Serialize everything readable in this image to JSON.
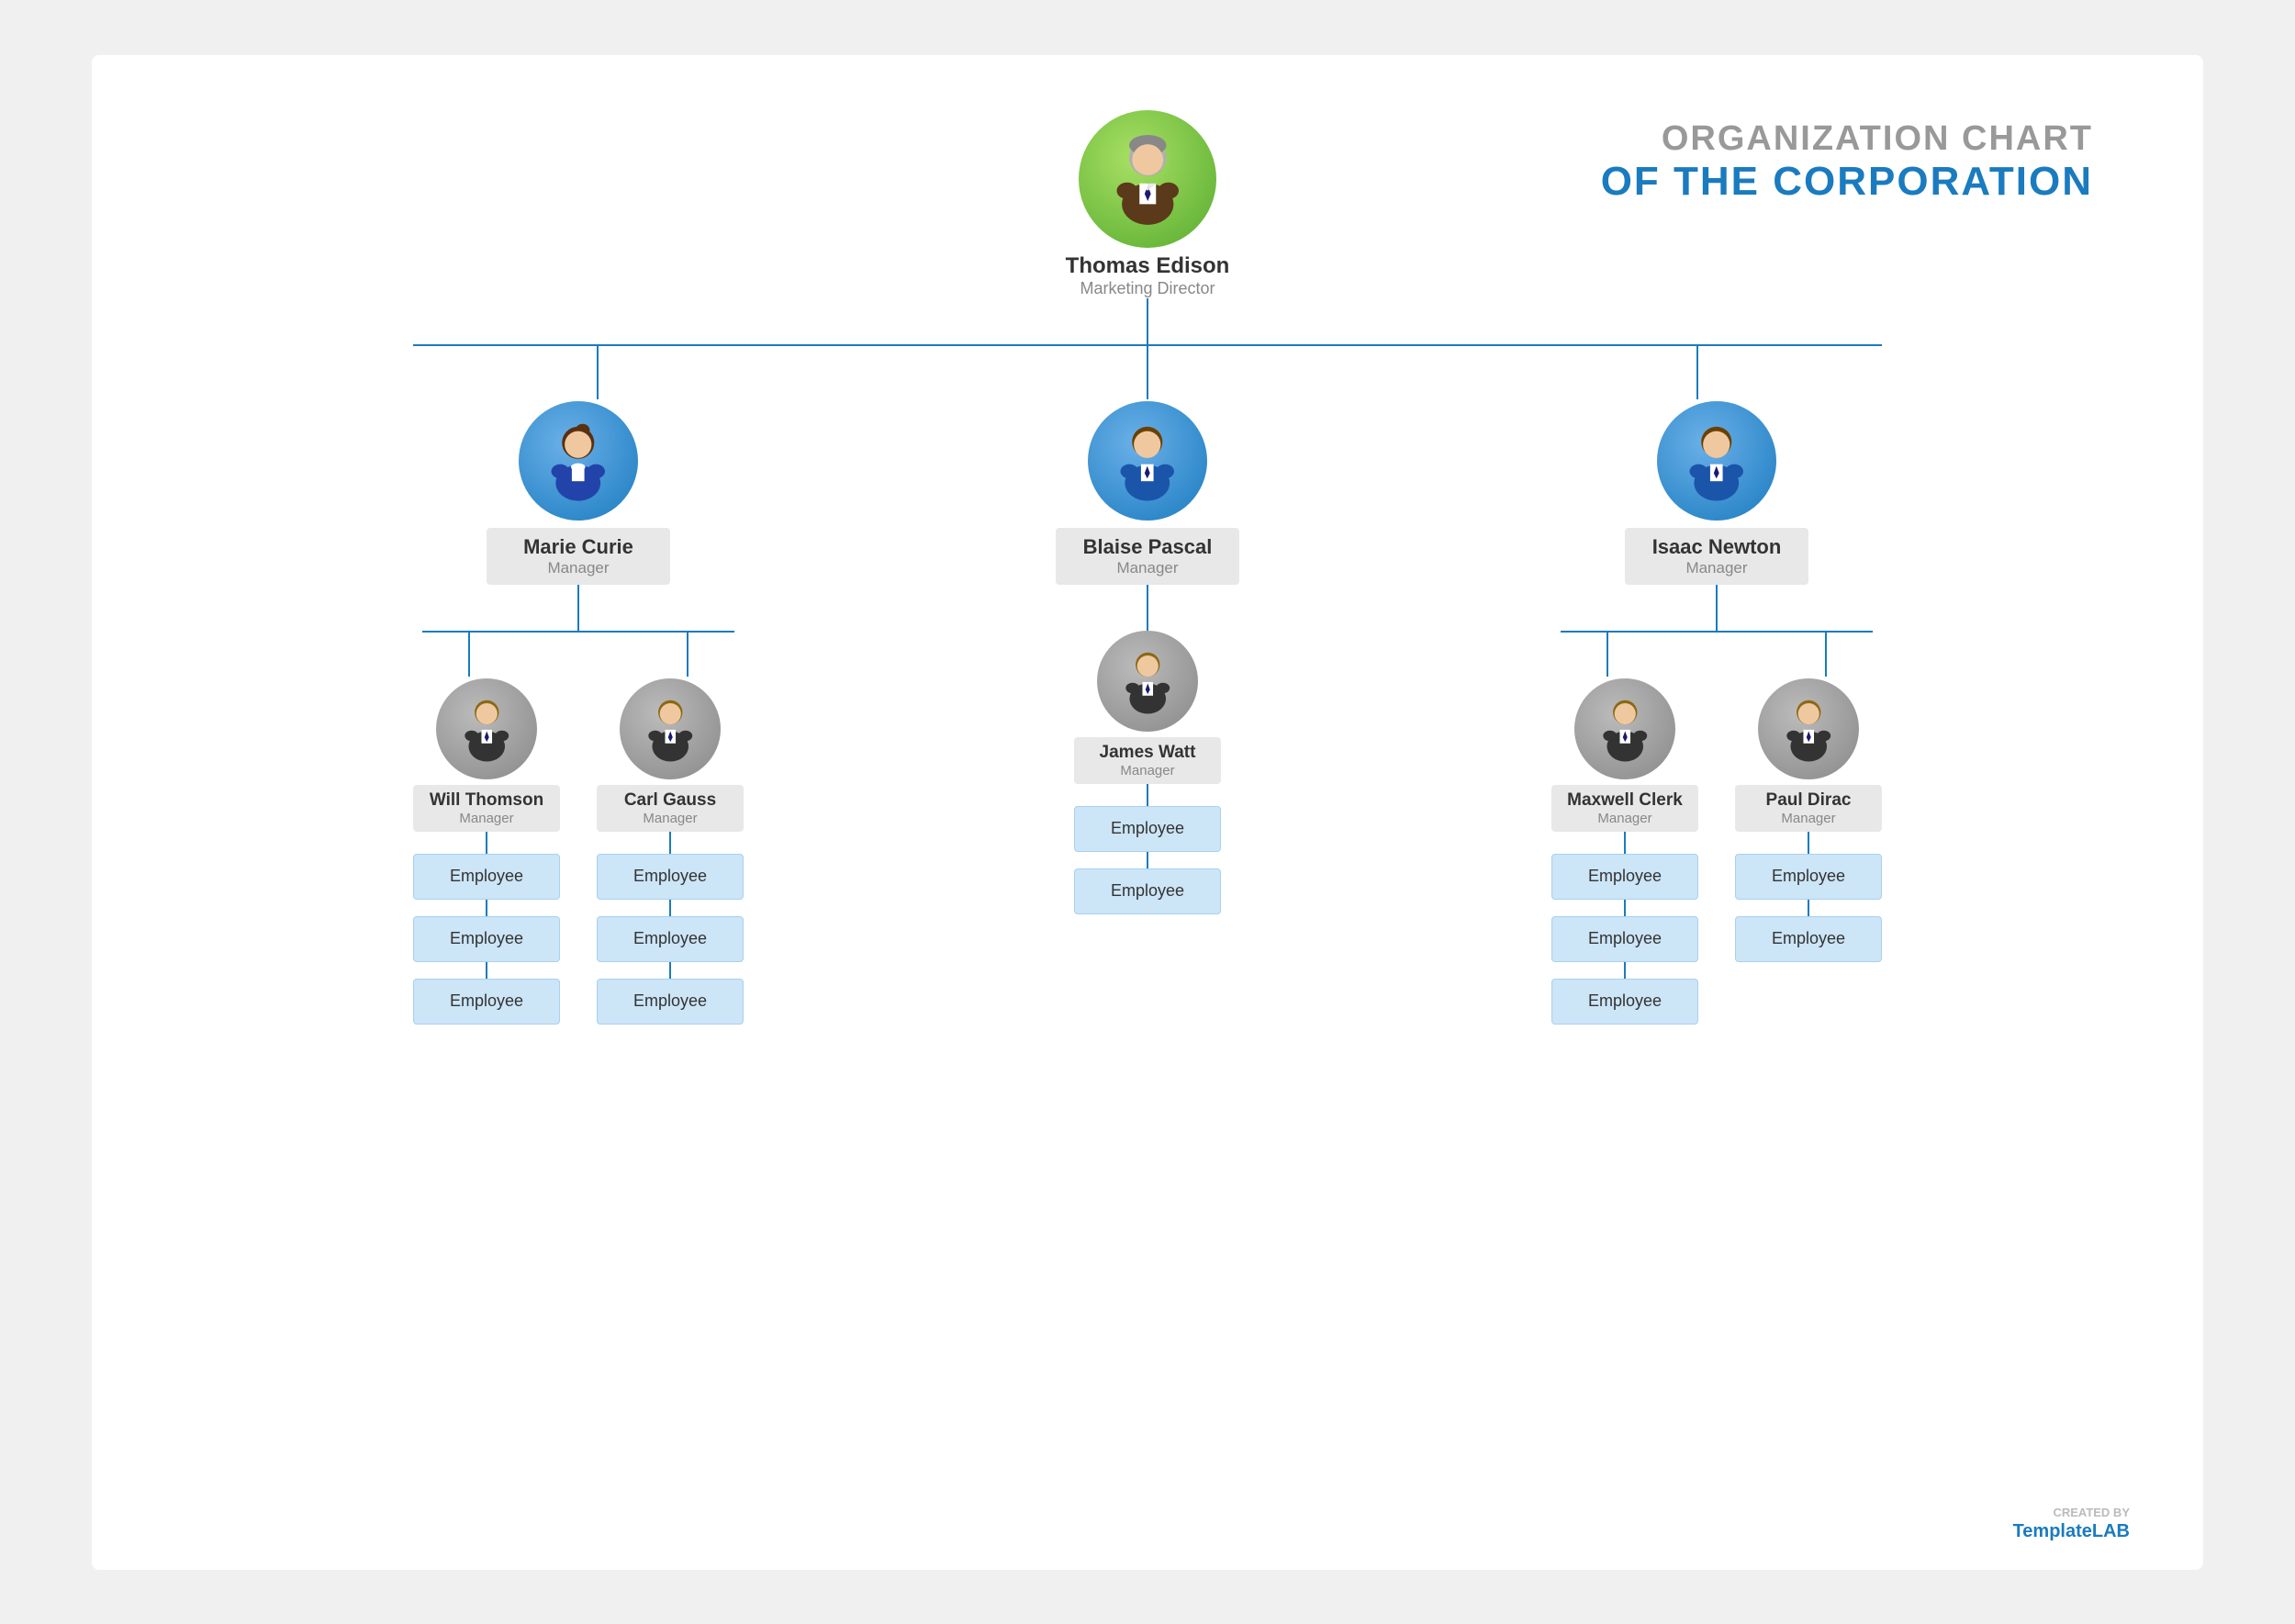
{
  "title": {
    "line1": "ORGANIZATION CHART",
    "line2": "OF THE CORPORATION"
  },
  "watermark": {
    "created_by": "CREATED BY",
    "brand1": "Template",
    "brand2": "LAB"
  },
  "top": {
    "name": "Thomas Edison",
    "role": "Marketing Director",
    "avatar_type": "green",
    "gender": "male"
  },
  "level2": [
    {
      "name": "Marie Curie",
      "role": "Manager",
      "avatar_type": "blue",
      "gender": "female",
      "children": [
        {
          "name": "Will Thomson",
          "role": "Manager",
          "avatar_type": "gray",
          "gender": "male",
          "employees": [
            "Employee",
            "Employee",
            "Employee"
          ]
        },
        {
          "name": "Carl Gauss",
          "role": "Manager",
          "avatar_type": "gray",
          "gender": "male",
          "employees": [
            "Employee",
            "Employee",
            "Employee"
          ]
        }
      ]
    },
    {
      "name": "Blaise Pascal",
      "role": "Manager",
      "avatar_type": "blue",
      "gender": "male",
      "children": [
        {
          "name": "James Watt",
          "role": "Manager",
          "avatar_type": "gray",
          "gender": "male",
          "employees": [
            "Employee",
            "Employee"
          ]
        }
      ]
    },
    {
      "name": "Isaac Newton",
      "role": "Manager",
      "avatar_type": "blue",
      "gender": "male",
      "children": [
        {
          "name": "Maxwell Clerk",
          "role": "Manager",
          "avatar_type": "gray",
          "gender": "male",
          "employees": [
            "Employee",
            "Employee",
            "Employee"
          ]
        },
        {
          "name": "Paul Dirac",
          "role": "Manager",
          "avatar_type": "gray",
          "gender": "male",
          "employees": [
            "Employee",
            "Employee"
          ]
        }
      ]
    }
  ]
}
